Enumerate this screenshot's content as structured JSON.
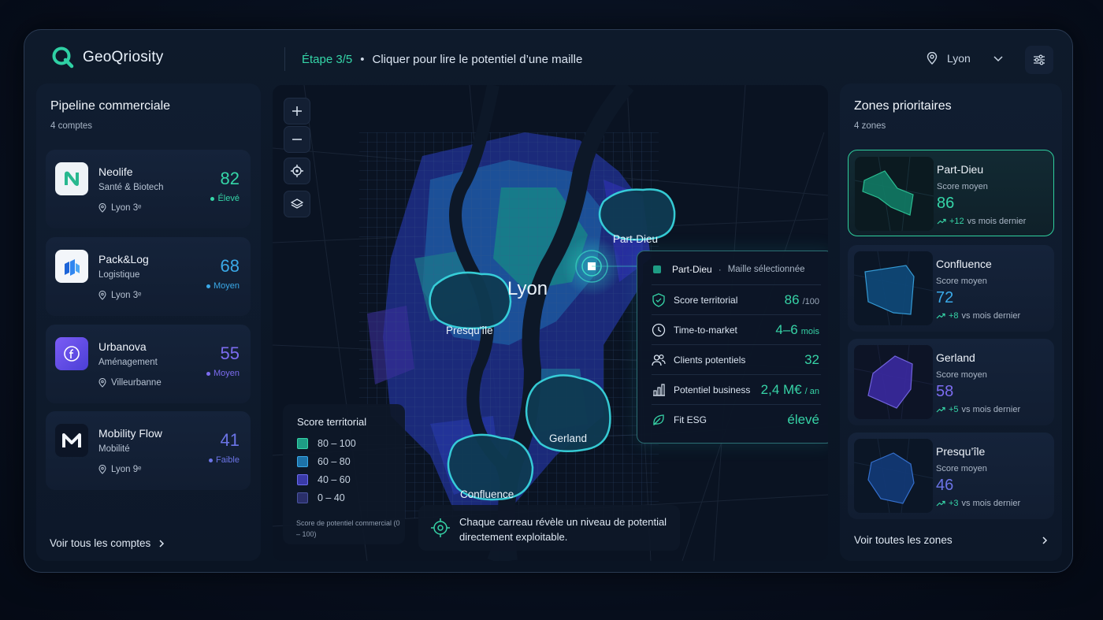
{
  "app": {
    "name": "GeoQriosity"
  },
  "header": {
    "step_label": "Étape 3/5",
    "step_sep": "•",
    "step_text": "Cliquer pour lire le potentiel d’une maille",
    "city": "Lyon"
  },
  "pipeline": {
    "title": "Pipeline commerciale",
    "count": "4 comptes",
    "accounts": [
      {
        "name": "Neolife",
        "sector": "Santé & Biotech",
        "location": "Lyon 3ᵉ",
        "score": "82",
        "level": "Élevé",
        "color": "#35d6a8",
        "logo": "neolife-logo"
      },
      {
        "name": "Pack&Log",
        "sector": "Logistique",
        "location": "Lyon 3ᵉ",
        "score": "68",
        "level": "Moyen",
        "color": "#3aa9e8",
        "logo": "packlog-logo"
      },
      {
        "name": "Urbanova",
        "sector": "Aménagement",
        "location": "Villeurbanne",
        "score": "55",
        "level": "Moyen",
        "color": "#7c6cf0",
        "logo": "urbanova-logo"
      },
      {
        "name": "Mobility Flow",
        "sector": "Mobilité",
        "location": "Lyon 9ᵉ",
        "score": "41",
        "level": "Faible",
        "color": "#6b74e6",
        "logo": "mobility-logo"
      }
    ],
    "see_all": "Voir tous les comptes"
  },
  "map": {
    "city_label": "Lyon",
    "areas": [
      "Part-Dieu",
      "Presqu'île",
      "Gerland",
      "Confluence"
    ],
    "legend": {
      "title": "Score territorial",
      "items": [
        {
          "label": "80 – 100",
          "color": "#1e9c84"
        },
        {
          "label": "60 – 80",
          "color": "#1d72a8"
        },
        {
          "label": "40 – 60",
          "color": "#3a3aa8"
        },
        {
          "label": "0 – 40",
          "color": "#2a2f6a"
        }
      ],
      "note": "Score de potentiel commercial (0 – 100)"
    },
    "hint": "Chaque carreau révèle un niveau de potential directement exploitable.",
    "tooltip": {
      "zone": "Part-Dieu",
      "sep": "·",
      "subtitle": "Maille sélectionnée",
      "rows": [
        {
          "label": "Score territorial",
          "value": "86",
          "unit": "/100",
          "icon": "shield-check-icon"
        },
        {
          "label": "Time-to-market",
          "value": "4–6",
          "unit": "mois",
          "icon": "clock-icon"
        },
        {
          "label": "Clients potentiels",
          "value": "32",
          "unit": "",
          "icon": "users-icon"
        },
        {
          "label": "Potentiel business",
          "value": "2,4 M€",
          "unit": "/ an",
          "icon": "bar-chart-icon"
        },
        {
          "label": "Fit ESG",
          "value": "élevé",
          "unit": "",
          "icon": "leaf-icon"
        }
      ]
    }
  },
  "zones": {
    "title": "Zones prioritaires",
    "count": "4 zones",
    "score_label": "Score moyen",
    "delta_suffix": "vs mois dernier",
    "items": [
      {
        "name": "Part-Dieu",
        "score": "86",
        "delta": "+12",
        "color": "#35d6a8"
      },
      {
        "name": "Confluence",
        "score": "72",
        "delta": "+8",
        "color": "#3aa9e8"
      },
      {
        "name": "Gerland",
        "score": "58",
        "delta": "+5",
        "color": "#7c6cf0"
      },
      {
        "name": "Presqu’île",
        "score": "46",
        "delta": "+3",
        "color": "#6b74e6"
      }
    ],
    "see_all": "Voir toutes les zones"
  }
}
